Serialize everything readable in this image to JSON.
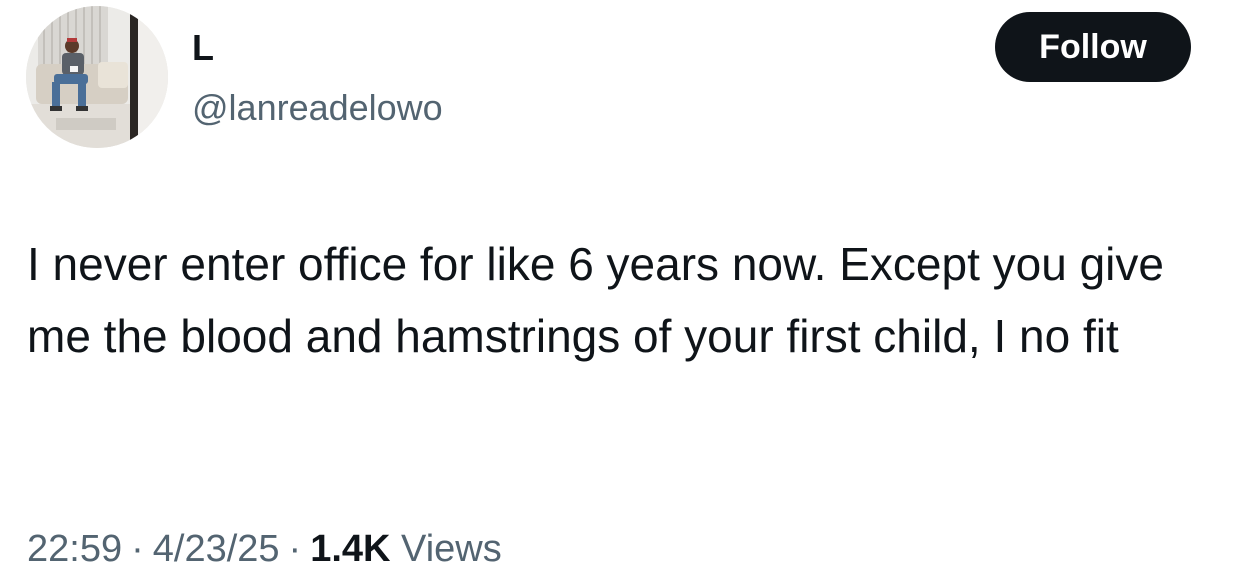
{
  "user": {
    "display_name": "L",
    "handle": "@lanreadelowo"
  },
  "actions": {
    "follow_label": "Follow"
  },
  "tweet": {
    "text": "I never enter office for like 6 years now. Except you give me the blood and hamstrings of your first child, I no fit"
  },
  "meta": {
    "time": "22:59",
    "separator": "·",
    "date": "4/23/25",
    "views_count": "1.4K",
    "views_label": "Views"
  },
  "colors": {
    "text_primary": "#0f1419",
    "text_secondary": "#536471",
    "button_bg": "#0f1419",
    "button_text": "#ffffff"
  }
}
